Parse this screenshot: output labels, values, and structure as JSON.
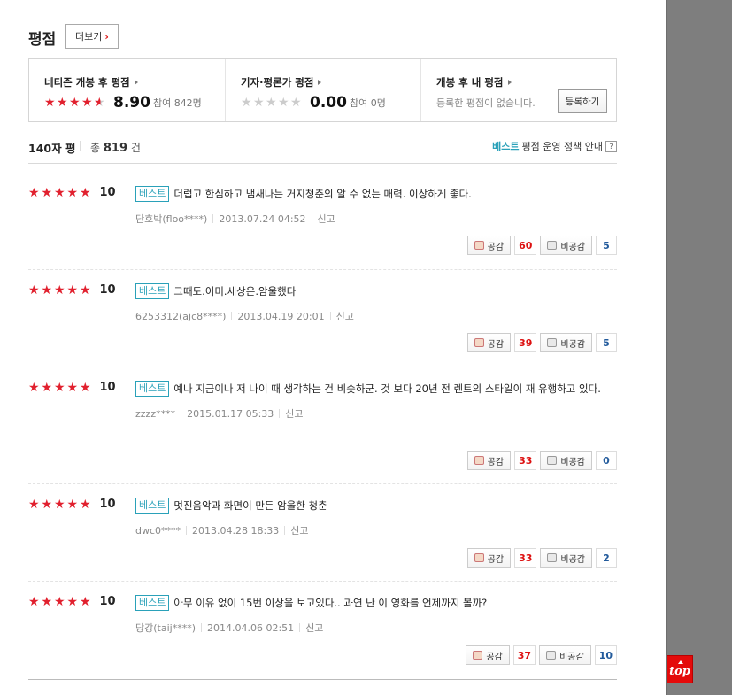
{
  "section": {
    "title": "평점",
    "more_label": "더보기"
  },
  "summary": {
    "netizen": {
      "label": "네티즌 개봉 후 평점",
      "score": "8.90",
      "count": "참여 842명",
      "star_fraction": 0.89
    },
    "critic": {
      "label": "기자·평론가 평점",
      "score": "0.00",
      "count": "참여 0명",
      "star_fraction": 0
    },
    "mine": {
      "label": "개봉 후 내 평점",
      "empty_text": "등록한 평점이 없습니다.",
      "button_label": "등록하기"
    }
  },
  "list": {
    "title": "140자 평",
    "total_prefix": "총",
    "total_count": "819",
    "total_suffix": "건",
    "policy_best": "베스트",
    "policy_rest": "평점 운영 정책 안내",
    "help_glyph": "?"
  },
  "labels": {
    "best": "베스트",
    "report": "신고",
    "like": "공감",
    "dislike": "비공감"
  },
  "colors": {
    "star_red": "#e1202e",
    "best_teal": "#2aa1b9",
    "like_red": "#dd1111",
    "dislike_blue": "#235b9c",
    "top_red": "#e40a0a"
  },
  "reviews": [
    {
      "score": "10",
      "text": "더럽고 한심하고 냄새나는 거지청춘의 알 수 없는 매력. 이상하게 좋다.",
      "user": "단호박(floo****)",
      "date": "2013.07.24 04:52",
      "likes": "60",
      "dislikes": "5"
    },
    {
      "score": "10",
      "text": "그때도.이미.세상은.암울했다",
      "user": "6253312(ajc8****)",
      "date": "2013.04.19 20:01",
      "likes": "39",
      "dislikes": "5"
    },
    {
      "score": "10",
      "text": "예나 지금이나 저 나이 때 생각하는 건 비슷하군. 것 보다 20년 전 렌트의 스타일이 재 유행하고 있다.",
      "user": "zzzz****",
      "date": "2015.01.17 05:33",
      "likes": "33",
      "dislikes": "0"
    },
    {
      "score": "10",
      "text": "멋진음악과 화면이 만든 암울한 청춘",
      "user": "dwc0****",
      "date": "2013.04.28 18:33",
      "likes": "33",
      "dislikes": "2"
    },
    {
      "score": "10",
      "text": "아무 이유 없이 15번 이상을 보고있다.. 과연 난 이 영화를 언제까지 볼까?",
      "user": "당강(taij****)",
      "date": "2014.04.06 02:51",
      "likes": "37",
      "dislikes": "10"
    }
  ],
  "top_button": {
    "label": "top"
  }
}
